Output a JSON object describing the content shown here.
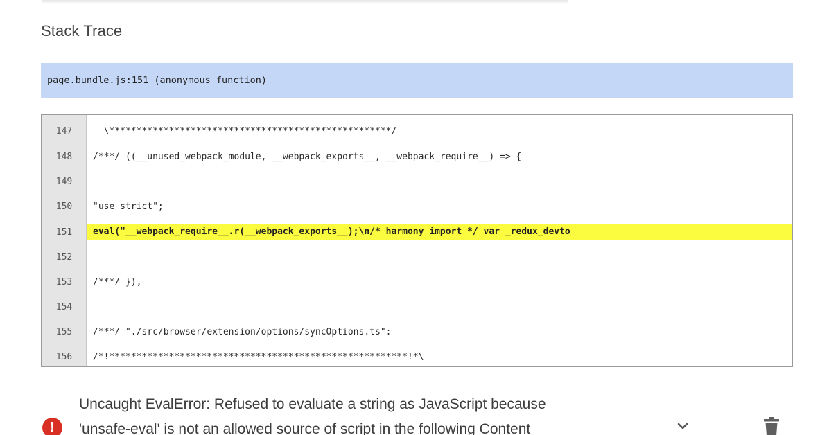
{
  "stack_trace": {
    "title": "Stack Trace",
    "frame": "page.bundle.js:151 (anonymous function)"
  },
  "code": {
    "lines": [
      {
        "num": "147",
        "text": "  \\****************************************************/"
      },
      {
        "num": "148",
        "text": "/***/ ((__unused_webpack_module, __webpack_exports__, __webpack_require__) => {"
      },
      {
        "num": "149",
        "text": ""
      },
      {
        "num": "150",
        "text": "\"use strict\";"
      },
      {
        "num": "151",
        "text": "eval(\"__webpack_require__.r(__webpack_exports__);\\n/* harmony import */ var _redux_devto"
      },
      {
        "num": "152",
        "text": ""
      },
      {
        "num": "153",
        "text": "/***/ }),"
      },
      {
        "num": "154",
        "text": ""
      },
      {
        "num": "155",
        "text": "/***/ \"./src/browser/extension/options/syncOptions.ts\":"
      },
      {
        "num": "156",
        "text": "/*!*******************************************************!*\\"
      }
    ],
    "highlighted_line": "151",
    "highlight_color": "#fbfb3f"
  },
  "error": {
    "line1": "Uncaught EvalError: Refused to evaluate a string as JavaScript because",
    "line2": "'unsafe-eval' is not an allowed source of script in the following Content",
    "icon": "error-icon",
    "icon_glyph": "!",
    "status_color": "#d93025"
  },
  "actions": {
    "expand_icon": "chevron-down-icon",
    "delete_icon": "trash-icon"
  }
}
